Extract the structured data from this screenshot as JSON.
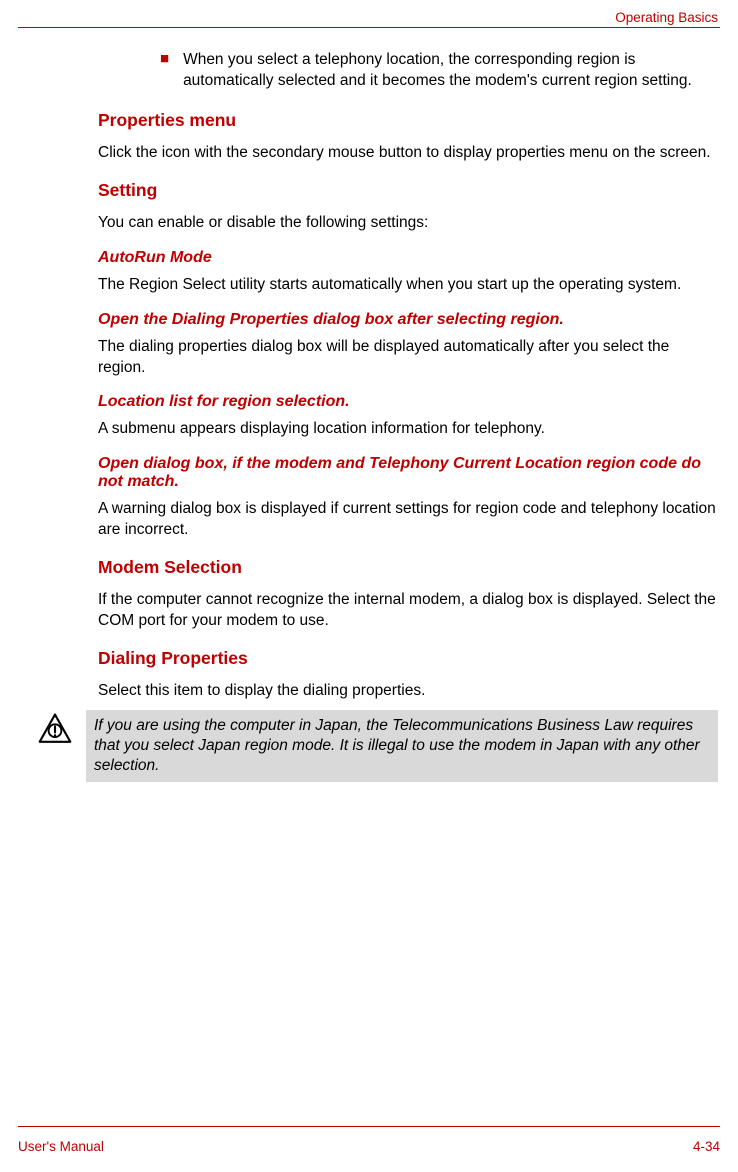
{
  "header": {
    "section_label": "Operating Basics"
  },
  "bullet": {
    "glyph": "■",
    "text": "When you select a telephony location, the corresponding region is automatically selected and it becomes the modem's current region setting."
  },
  "sections": {
    "properties_menu": {
      "heading": "Properties menu",
      "body": "Click the icon with the secondary mouse button to display properties menu on the screen."
    },
    "setting": {
      "heading": "Setting",
      "intro": "You can enable or disable the following settings:",
      "items": [
        {
          "title": "AutoRun Mode",
          "body": "The Region Select utility starts automatically when you start up the operating system."
        },
        {
          "title": "Open the Dialing Properties dialog box after selecting region.",
          "body": "The dialing properties dialog box will be displayed automatically after you select the region."
        },
        {
          "title": "Location list for region selection.",
          "body": "A submenu appears displaying location information for telephony."
        },
        {
          "title": "Open dialog box, if the modem and Telephony Current Location region code do not match.",
          "body": "A warning dialog box is displayed if current settings for region code and telephony location are incorrect."
        }
      ]
    },
    "modem_selection": {
      "heading": "Modem Selection",
      "body": "If the computer cannot recognize the internal modem, a dialog box is displayed. Select the COM port for your modem to use."
    },
    "dialing_properties": {
      "heading": "Dialing Properties",
      "body": "Select this item to display the dialing properties."
    }
  },
  "note": {
    "text": "If you are using the computer in Japan, the Telecommunications Business Law requires that you select Japan region mode. It is illegal to use the modem in Japan with any other selection."
  },
  "footer": {
    "left": "User's Manual",
    "right": "4-34"
  }
}
